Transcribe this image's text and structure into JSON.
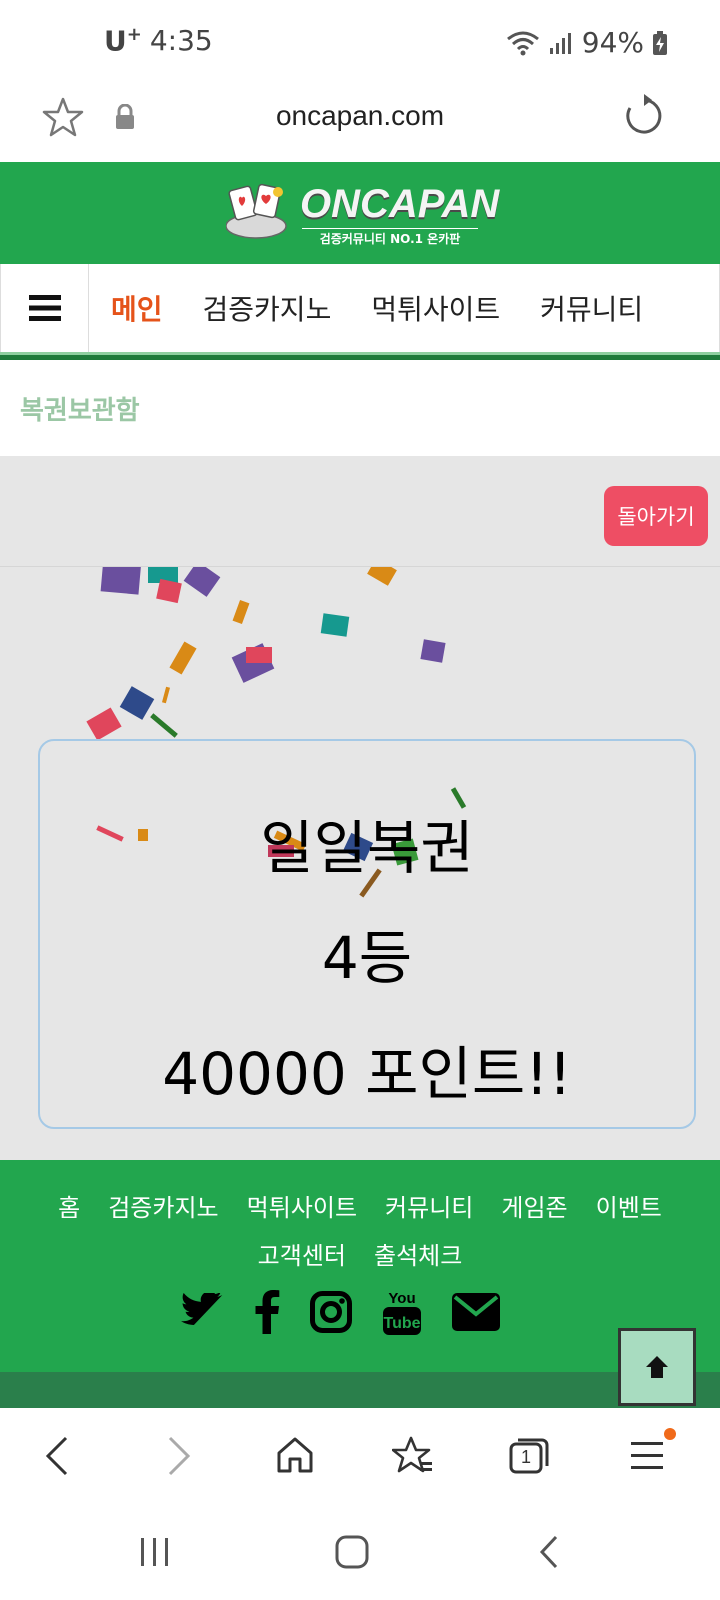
{
  "status_bar": {
    "carrier": "U",
    "carrier_sup": "+",
    "time": "4:35",
    "battery": "94%"
  },
  "url_bar": {
    "url": "oncapan.com"
  },
  "site": {
    "logo_text": "ONCAPAN",
    "logo_sub": "검증커뮤니티 NO.1 온카판"
  },
  "nav": {
    "items": [
      "메인",
      "검증카지노",
      "먹튀사이트",
      "커뮤니티"
    ]
  },
  "breadcrumb": "복권보관함",
  "back_button": "돌아가기",
  "result": {
    "title": "일일복권",
    "rank": "4등",
    "points": "40000 포인트!!"
  },
  "footer": {
    "links": [
      "홈",
      "검증카지노",
      "먹튀사이트",
      "커뮤니티",
      "게임존",
      "이벤트",
      "고객센터",
      "출석체크"
    ],
    "social": [
      "twitter-icon",
      "facebook-icon",
      "instagram-icon",
      "youtube-icon",
      "mail-icon"
    ]
  },
  "browser_toolbar": {
    "tabs_count": "1"
  },
  "colors": {
    "brand_green": "#22a64e",
    "active_nav": "#e5531a",
    "back_button": "#ee4e64"
  }
}
